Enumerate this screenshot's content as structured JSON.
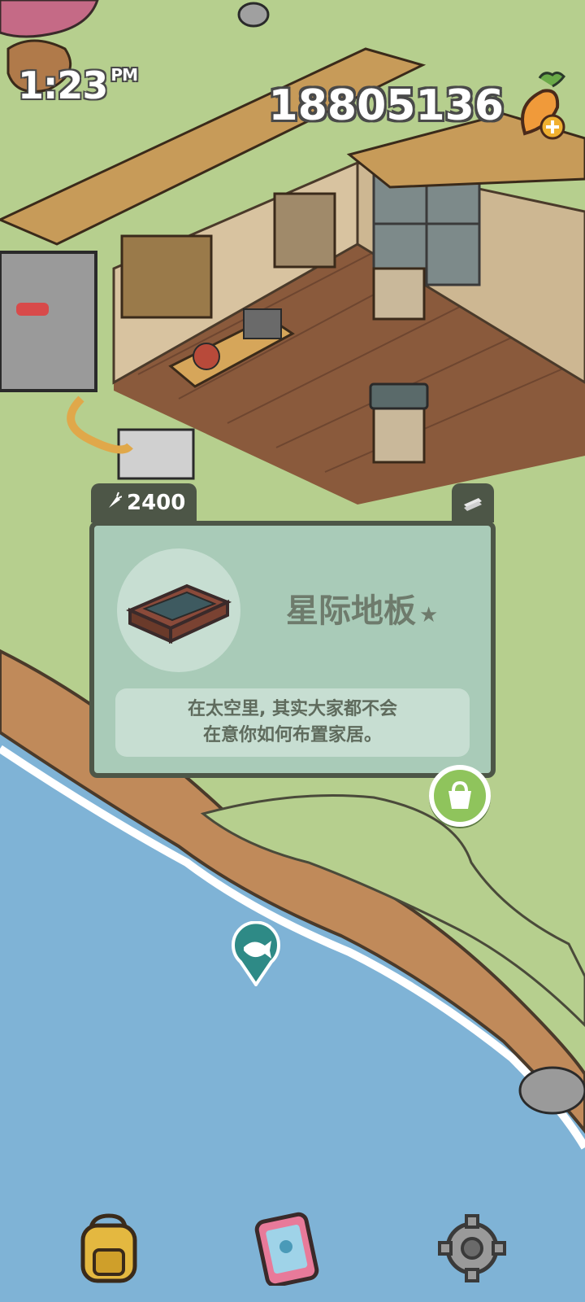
{
  "status_bar": {
    "time": "1:23",
    "ampm": "PM"
  },
  "hud": {
    "carrot_count": "18805136",
    "add_carrot_icon": "carrot-plus-icon"
  },
  "item_card": {
    "price": "2400",
    "name": "星际地板",
    "rarity_star": "★",
    "description_line1": "在太空里, 其实大家都不会",
    "description_line2": "在意你如何布置家居。"
  },
  "buttons": {
    "bag": "shopping-bag-icon",
    "fish_spot": "fish-icon",
    "backpack": "backpack-icon",
    "phone": "phone-map-icon",
    "settings": "gear-icon"
  },
  "colors": {
    "card_bg": "#a9cbb8",
    "card_border": "#4d5647",
    "grass": "#b6cf8e",
    "water": "#7fb3d6",
    "accent_green": "#8fc45c"
  }
}
